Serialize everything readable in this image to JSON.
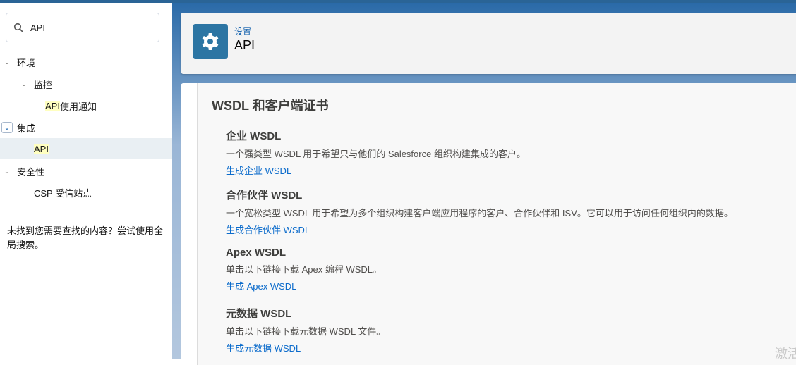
{
  "search": {
    "value": "API"
  },
  "tree": [
    {
      "label": "环境"
    },
    {
      "label": "监控"
    },
    {
      "highlight": "API",
      "label": " 使用通知"
    },
    {
      "label": "集成"
    },
    {
      "highlight": "API",
      "label": ""
    },
    {
      "label": "安全性"
    },
    {
      "label": "CSP 受信站点"
    }
  ],
  "hint": "未找到您需要查找的内容？尝试使用全局搜索。",
  "header": {
    "breadcrumb": "设置",
    "title": "API"
  },
  "content": {
    "heading": "WSDL 和客户端证书",
    "sections": [
      {
        "title": "企业 WSDL",
        "desc": "一个强类型 WSDL 用于希望只与他们的 Salesforce 组织构建集成的客户。",
        "link": "生成企业 WSDL"
      },
      {
        "title": "合作伙伴 WSDL",
        "desc": "一个宽松类型 WSDL 用于希望为多个组织构建客户端应用程序的客户、合作伙伴和 ISV。它可以用于访问任何组织内的数据。",
        "link": "生成合作伙伴 WSDL"
      },
      {
        "title": "Apex WSDL",
        "desc": "单击以下链接下载 Apex 编程 WSDL。",
        "link": "生成 Apex WSDL"
      },
      {
        "title": "元数据 WSDL",
        "desc": "单击以下链接下载元数据 WSDL 文件。",
        "link": "生成元数据 WSDL"
      }
    ]
  },
  "watermark": "激活"
}
